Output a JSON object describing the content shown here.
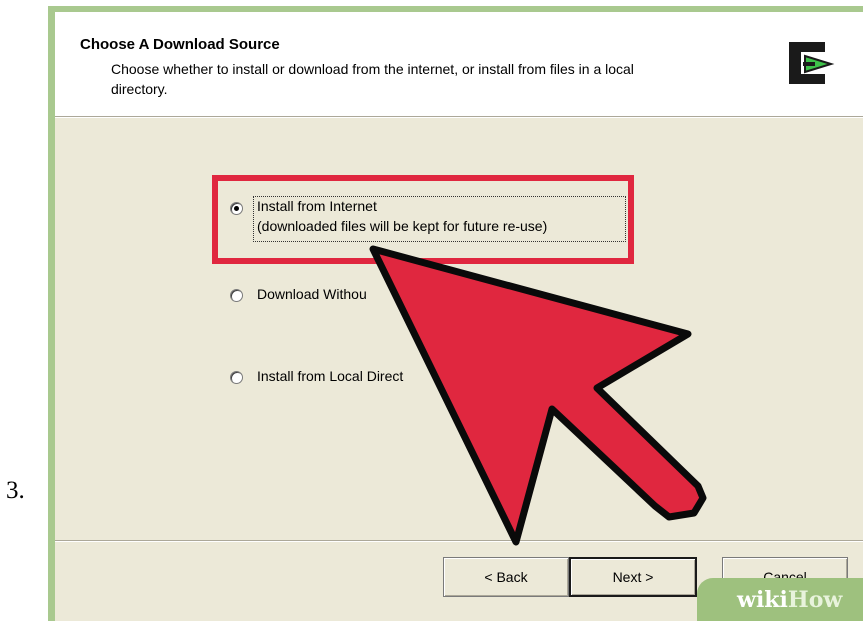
{
  "step": {
    "number": "3."
  },
  "header": {
    "title": "Choose A Download Source",
    "description": "Choose whether to install or download from the internet, or install from files in a local directory."
  },
  "options": [
    {
      "line1": "Install from Internet",
      "line2": "(downloaded files will be kept for future re-use)",
      "selected": true
    },
    {
      "line1": "Download Withou",
      "selected": false
    },
    {
      "line1": "Install from Local Direct",
      "selected": false
    }
  ],
  "buttons": {
    "back": "< Back",
    "next": "Next >",
    "cancel": "Cancel"
  },
  "watermark": {
    "part1": "wiki",
    "part2": "How"
  },
  "colors": {
    "highlight": "#e0273f",
    "arrow": "#e0273f",
    "dialog_bg": "#ece9d8",
    "frame": "#a9c98f"
  },
  "icons": {
    "logo": "cygwin-logo-icon",
    "pointer": "arrow-pointer-icon"
  }
}
